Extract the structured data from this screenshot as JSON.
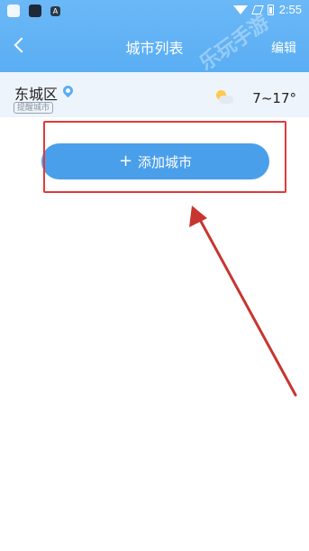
{
  "status_bar": {
    "time": "2:55"
  },
  "nav": {
    "title": "城市列表",
    "edit_label": "编辑"
  },
  "city": {
    "name": "东城区",
    "badge": "提醒城市",
    "temperature": "7~17°",
    "weather_icon": "partly-cloudy-icon"
  },
  "add_button": {
    "plus": "+",
    "label": "添加城市"
  },
  "watermark": {
    "text": "乐玩手游"
  },
  "colors": {
    "header": "#5aaef3",
    "button": "#4a9fea",
    "highlight": "#e03a3a",
    "row_bg": "#eef4fb"
  }
}
